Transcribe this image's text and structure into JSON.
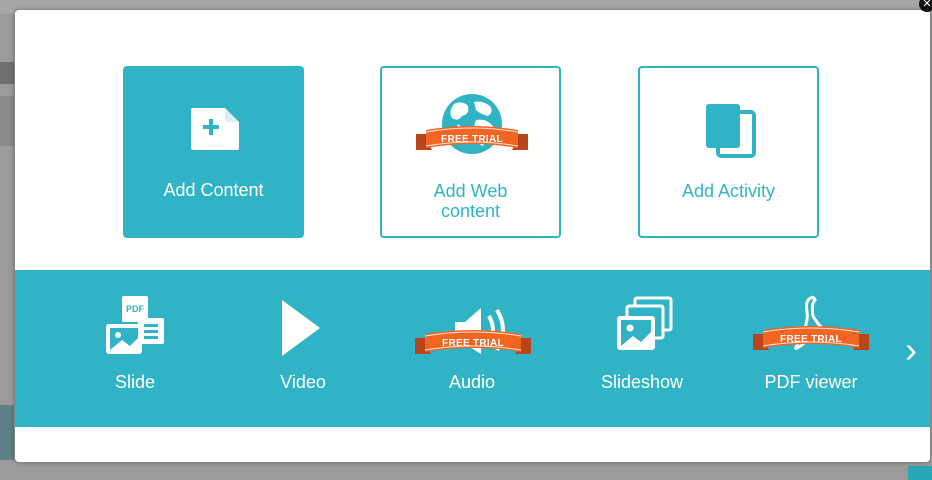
{
  "modal": {
    "close_icon": "close-icon"
  },
  "tiles": [
    {
      "label": "Add Content",
      "icon": "add-file-icon",
      "badge": ""
    },
    {
      "label_line1": "Add Web",
      "label_line2": "content",
      "icon": "globe-icon",
      "badge": "FREE TRIAL"
    },
    {
      "label": "Add Activity",
      "icon": "activity-pages-icon",
      "badge": ""
    }
  ],
  "bar_items": [
    {
      "label": "Slide",
      "icon": "pdf-slide-icon",
      "badge": "",
      "icon_text": "PDF"
    },
    {
      "label": "Video",
      "icon": "play-icon",
      "badge": ""
    },
    {
      "label": "Audio",
      "icon": "speaker-icon",
      "badge": "FREE TRIAL"
    },
    {
      "label": "Slideshow",
      "icon": "image-stack-icon",
      "badge": ""
    },
    {
      "label": "PDF viewer",
      "icon": "acrobat-icon",
      "badge": "FREE TRIAL"
    }
  ],
  "next_arrow": "›",
  "colors": {
    "accent": "#30b4c5",
    "ribbon": "#f26522",
    "ribbon_dark": "#b8461a",
    "white": "#ffffff"
  }
}
